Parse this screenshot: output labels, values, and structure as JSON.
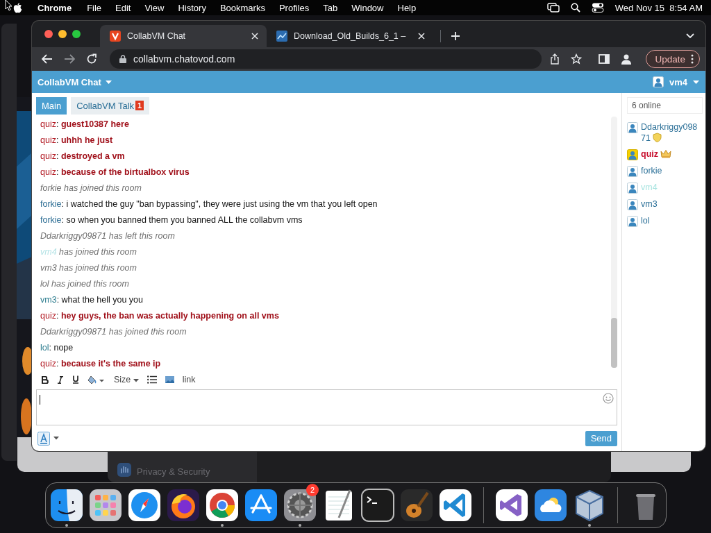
{
  "menubar": {
    "app": "Chrome",
    "menus": [
      "File",
      "Edit",
      "View",
      "History",
      "Bookmarks",
      "Profiles",
      "Tab",
      "Window",
      "Help"
    ],
    "clock": "Wed Nov 15  8:54 AM"
  },
  "background": {
    "settings_item": "Privacy & Security"
  },
  "browser": {
    "tabs": [
      {
        "title": "CollabVM Chat",
        "selected": true
      },
      {
        "title": "Download_Old_Builds_6_1 –",
        "selected": false
      }
    ],
    "url": "collabvm.chatovod.com",
    "update_button": "Update"
  },
  "chat": {
    "title": "CollabVM Chat",
    "current_user": "vm4",
    "rooms": [
      {
        "name": "Main",
        "selected": true
      },
      {
        "name": "CollabVM Talk",
        "selected": false,
        "unread": "1"
      }
    ],
    "messages": [
      {
        "kind": "chat",
        "user": "quiz",
        "color": "#b0141e",
        "sep": ":",
        "text": "guest10387 here",
        "bold": true
      },
      {
        "kind": "chat",
        "user": "quiz",
        "color": "#b0141e",
        "sep": ":",
        "text": "uhhh he just",
        "bold": true
      },
      {
        "kind": "chat",
        "user": "quiz",
        "color": "#b0141e",
        "sep": ":",
        "text": "destroyed a vm",
        "bold": true
      },
      {
        "kind": "chat",
        "user": "quiz",
        "color": "#b0141e",
        "sep": ":",
        "text": "because of the birtualbox virus",
        "bold": true
      },
      {
        "kind": "system",
        "user": "forkie",
        "color": "#6f6f6f",
        "text": "has joined this room"
      },
      {
        "kind": "chat",
        "user": "forkie",
        "color": "#2b6c93",
        "sep": ":",
        "text": "i watched the guy \"ban bypassing\", they were just using the vm that you left open",
        "bold": false
      },
      {
        "kind": "chat",
        "user": "forkie",
        "color": "#2b6c93",
        "sep": ":",
        "text": "so when you banned them you banned ALL the collabvm vms",
        "bold": false
      },
      {
        "kind": "system",
        "user": "Ddarkriggy09871",
        "color": "#6f6f6f",
        "text": "has left this room"
      },
      {
        "kind": "system",
        "user": "vm4",
        "color": "#b5e3e6",
        "text": "has joined this room"
      },
      {
        "kind": "system",
        "user": "vm3",
        "color": "#6f6f6f",
        "text": "has joined this room"
      },
      {
        "kind": "system",
        "user": "lol",
        "color": "#6f6f6f",
        "text": "has joined this room"
      },
      {
        "kind": "chat",
        "user": "vm3",
        "color": "#2d7d8f",
        "sep": ":",
        "text": "what the hell you you",
        "bold": false
      },
      {
        "kind": "chat",
        "user": "quiz",
        "color": "#b0141e",
        "sep": ":",
        "text": "hey guys, the ban was actually happening on all vms",
        "bold": true
      },
      {
        "kind": "system",
        "user": "Ddarkriggy09871",
        "color": "#6f6f6f",
        "text": "has joined this room"
      },
      {
        "kind": "chat",
        "user": "lol",
        "color": "#2d7d8f",
        "sep": ":",
        "text": "nope",
        "bold": false
      },
      {
        "kind": "chat",
        "user": "quiz",
        "color": "#b0141e",
        "sep": ":",
        "text": "because it's the same ip",
        "bold": true
      }
    ],
    "editor": {
      "size_label": "Size",
      "link_label": "link"
    },
    "send_button": "Send",
    "online_count": "6 online",
    "users": [
      {
        "name": "Ddarkriggy09871",
        "color": "#2a6f97",
        "kind": "moderator",
        "highlighted": false
      },
      {
        "name": "quiz",
        "color": "#c8102e",
        "kind": "owner",
        "highlighted": true
      },
      {
        "name": "forkie",
        "color": "#2a6f97",
        "kind": "user",
        "highlighted": false
      },
      {
        "name": "vm4",
        "color": "#a8e4e0",
        "kind": "user",
        "highlighted": false
      },
      {
        "name": "vm3",
        "color": "#2a6f97",
        "kind": "user",
        "highlighted": false
      },
      {
        "name": "lol",
        "color": "#2a6f97",
        "kind": "user",
        "highlighted": false
      }
    ]
  },
  "dock": {
    "apps": [
      {
        "kind": "finder",
        "running": true
      },
      {
        "kind": "launchpad",
        "running": false
      },
      {
        "kind": "safari",
        "running": false
      },
      {
        "kind": "firefox",
        "running": false
      },
      {
        "kind": "chrome",
        "running": true
      },
      {
        "kind": "appstore",
        "running": false
      },
      {
        "kind": "settings",
        "running": true,
        "badge": "2"
      },
      {
        "kind": "textedit",
        "running": false
      },
      {
        "kind": "terminal",
        "running": false
      },
      {
        "kind": "guitar",
        "running": false
      },
      {
        "kind": "vscode",
        "running": false
      }
    ],
    "recent": [
      {
        "kind": "vstudio",
        "running": false
      },
      {
        "kind": "weather",
        "running": false
      },
      {
        "kind": "virtualbox",
        "running": true
      }
    ],
    "trash": [
      {
        "kind": "trash",
        "running": false
      }
    ]
  }
}
